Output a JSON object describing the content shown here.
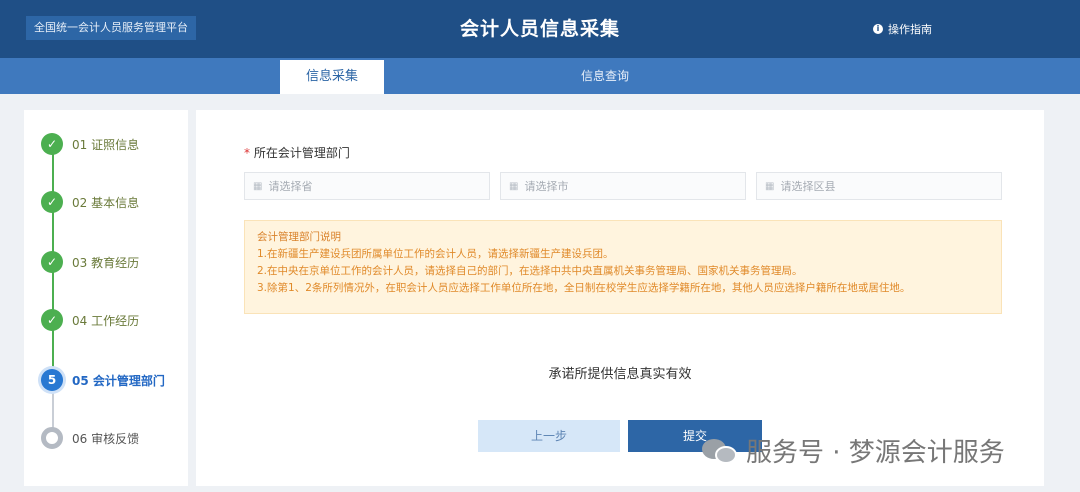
{
  "header": {
    "brand": "全国统一会计人员服务管理平台",
    "title": "会计人员信息采集",
    "guide_icon": "info-icon",
    "guide_label": "操作指南"
  },
  "tabs": [
    {
      "label": "信息采集",
      "active": true
    },
    {
      "label": "信息查询",
      "active": false
    }
  ],
  "steps": [
    {
      "label": "01 证照信息",
      "status": "done"
    },
    {
      "label": "02 基本信息",
      "status": "done"
    },
    {
      "label": "03 教育经历",
      "status": "done"
    },
    {
      "label": "04 工作经历",
      "status": "done"
    },
    {
      "label": "05 会计管理部门",
      "status": "current",
      "marker": "5"
    },
    {
      "label": "06 审核反馈",
      "status": "pending"
    }
  ],
  "form": {
    "required_mark": "*",
    "section_label": "所在会计管理部门",
    "selects": [
      {
        "placeholder": "请选择省"
      },
      {
        "placeholder": "请选择市"
      },
      {
        "placeholder": "请选择区县"
      }
    ],
    "notice": {
      "title": "会计管理部门说明",
      "lines": [
        "1.在新疆生产建设兵团所属单位工作的会计人员，请选择新疆生产建设兵团。",
        "2.在中央在京单位工作的会计人员，请选择自己的部门，在选择中共中央直属机关事务管理局、国家机关事务管理局。",
        "3.除第1、2条所列情况外，在职会计人员应选择工作单位所在地，全日制在校学生应选择学籍所在地，其他人员应选择户籍所在地或居住地。"
      ]
    },
    "commit_text": "承诺所提供信息真实有效",
    "prev_button": "上一步",
    "next_button": "提交"
  },
  "watermark": {
    "text": "服务号 · 梦源会计服务"
  },
  "colors": {
    "header": "#1f4f86",
    "tabbar": "#3f79be",
    "done": "#4caf50",
    "current": "#2878d2",
    "notice_bg": "#fff4de",
    "notice_text": "#e08a2a"
  }
}
